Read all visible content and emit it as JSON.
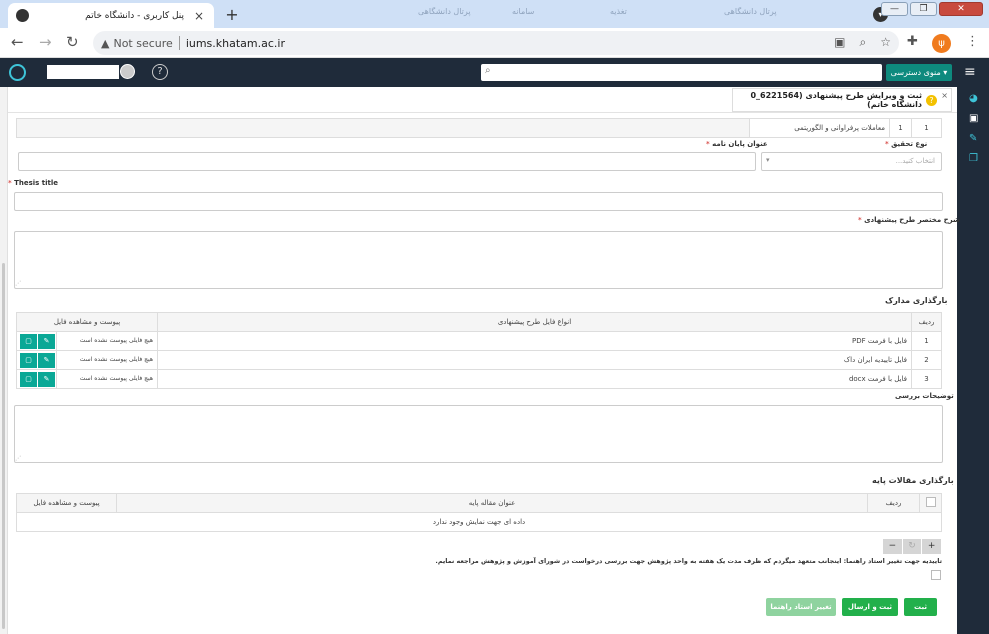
{
  "browser": {
    "tab_title": "پنل کاربری - دانشگاه خاتم",
    "tab_close": "×",
    "new_tab": "+",
    "ghost_tabs": [
      "پرتال دانشگاهی",
      "سامانه",
      "تغذیه",
      "پرتال دانشگاهی"
    ],
    "window_buttons": [
      "—",
      "❐",
      "✕"
    ],
    "security_label": "Not secure",
    "url": "iums.khatam.ac.ir"
  },
  "app_header": {
    "access_label": "منوی دسترسی",
    "help_label": "?",
    "menu_label": "≡"
  },
  "panel_tab": {
    "title": "ثبت و ویرایش طرح پیشنهادی (6221564_0 دانشگاه خاتم)",
    "help_badge": "?",
    "close": "×"
  },
  "top_row": {
    "row": "1",
    "number": "1",
    "name": "معاملات پرفراوانی و الگوریتمی"
  },
  "form": {
    "research_type_label": "نوع تحقیق",
    "research_type_placeholder": "انتخاب کنید...",
    "thesis_title_fa_label": "عنوان پایان نامه",
    "thesis_title_en_label": "Thesis title",
    "summary_label": "شرح مختصر طرح پیشنهادی",
    "required_mark": "*"
  },
  "documents": {
    "heading": "بارگذاری مدارک",
    "columns": {
      "row": "ردیف",
      "type": "انواع فایل طرح پیشنهادی",
      "attach": "پیوست و مشاهده فایل"
    },
    "rows": [
      {
        "n": "1",
        "type": "فایل با فرمت PDF",
        "status": "هیچ فایلی پیوست نشده است"
      },
      {
        "n": "2",
        "type": "فایل تاییدیه ایران داک",
        "status": "هیچ فایلی پیوست نشده است"
      },
      {
        "n": "3",
        "type": "فایل با فرمت docx",
        "status": "هیچ فایلی پیوست نشده است"
      }
    ],
    "edit_icon_glyph": "✎",
    "view_icon_glyph": "▢"
  },
  "review_notes": {
    "label": "توضیحات بررسی"
  },
  "base_articles": {
    "heading": "بارگذاری مقالات پایه",
    "columns": {
      "row": "ردیف",
      "title": "عنوان مقاله پایه",
      "attach": "پیوست و مشاهده فایل"
    },
    "empty_text": "داده ای جهت نمایش وجود ندارد",
    "pager": {
      "add": "+",
      "refresh": "↻",
      "remove": "−"
    }
  },
  "confirmation": {
    "text": "تاییدیه جهت تغییر استاد راهنما: اینجانب متعهد میگردم که ظرف مدت یک هفته به واحد پژوهش جهت بررسی درخواست در شورای آموزش و پژوهش مراجعه نمایم."
  },
  "actions": {
    "save": "ثبت",
    "save_send": "ثبت و ارسال",
    "change_advisor": "تغییر استاد راهنما"
  },
  "colors": {
    "app_header": "#1f2b3a",
    "accent_teal": "#0aa896",
    "save_green": "#22b04b",
    "disabled_green": "#8fd39f",
    "required_red": "#d9534f"
  }
}
